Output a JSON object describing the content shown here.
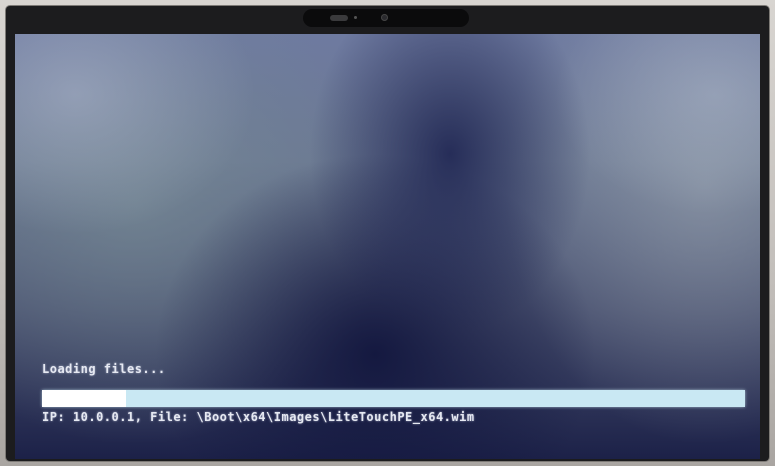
{
  "boot_screen": {
    "loading_label": "Loading files...",
    "progress": {
      "fraction": 0.12,
      "fill_color": "#ffffff",
      "track_color": "#c9e8f3"
    },
    "status_line": "IP: 10.0.0.1, File: \\Boot\\x64\\Images\\LiteTouchPE_x64.wim"
  },
  "device": {
    "camera_icons": [
      "camera-sensor-icon",
      "camera-led-icon",
      "camera-lens-icon"
    ]
  }
}
